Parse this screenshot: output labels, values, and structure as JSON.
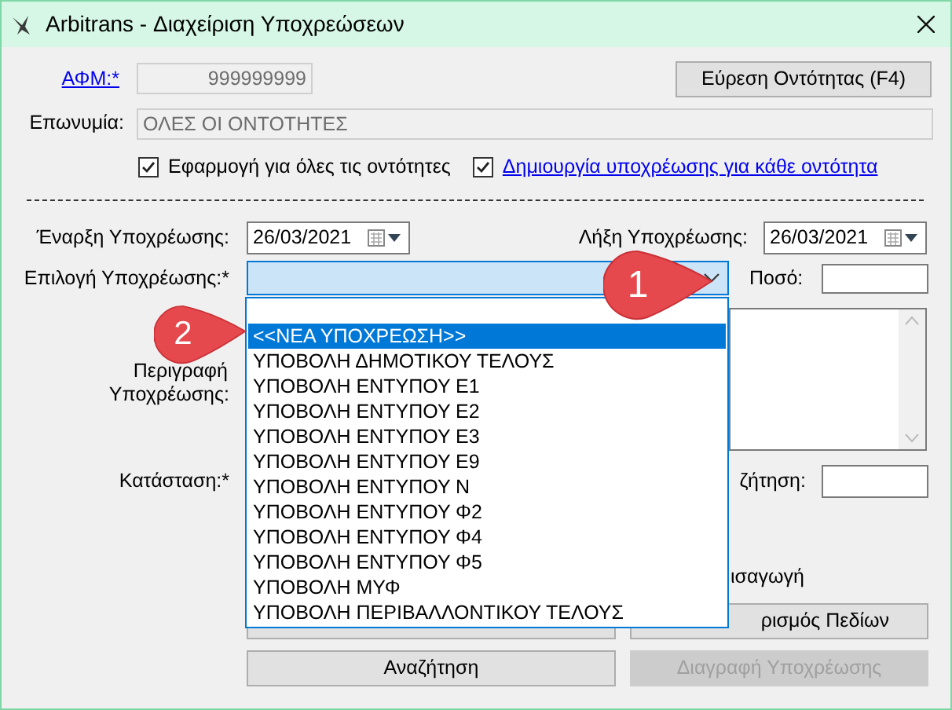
{
  "window": {
    "title": "Arbitrans - Διαχείριση Υποχρεώσεων"
  },
  "afm": {
    "label": "ΑΦΜ:*",
    "value": "999999999"
  },
  "find_button": {
    "label": "Εύρεση Οντότητας (F4)"
  },
  "name_field": {
    "label": "Επωνυμία:",
    "value": "ΟΛΕΣ ΟΙ ΟΝΤΟΤΗΤΕΣ"
  },
  "checkboxes": [
    {
      "label": "Εφαρμογή για όλες τις οντότητες",
      "checked": true,
      "kind": "plain"
    },
    {
      "label": "Δημιουργία υποχρέωσης για κάθε οντότητα",
      "checked": true,
      "kind": "link"
    }
  ],
  "start_date": {
    "label": "Έναρξη Υποχρέωσης:",
    "value": "26/03/2021"
  },
  "end_date": {
    "label": "Λήξη Υποχρέωσης:",
    "value": "26/03/2021"
  },
  "obligation": {
    "label": "Επιλογή Υποχρέωσης:*",
    "expanded": true,
    "options": [
      {
        "label": "<<ΝΕΑ ΥΠΟΧΡΕΩΣΗ>>",
        "selected": true
      },
      {
        "label": "ΥΠΟΒΟΛΗ ΔΗΜΟΤΙΚΟΥ ΤΕΛΟΥΣ",
        "selected": false
      },
      {
        "label": "ΥΠΟΒΟΛΗ ΕΝΤΥΠΟΥ Ε1",
        "selected": false
      },
      {
        "label": "ΥΠΟΒΟΛΗ ΕΝΤΥΠΟΥ Ε2",
        "selected": false
      },
      {
        "label": "ΥΠΟΒΟΛΗ ΕΝΤΥΠΟΥ Ε3",
        "selected": false
      },
      {
        "label": "ΥΠΟΒΟΛΗ ΕΝΤΥΠΟΥ Ε9",
        "selected": false
      },
      {
        "label": "ΥΠΟΒΟΛΗ ΕΝΤΥΠΟΥ Ν",
        "selected": false
      },
      {
        "label": "ΥΠΟΒΟΛΗ ΕΝΤΥΠΟΥ Φ2",
        "selected": false
      },
      {
        "label": "ΥΠΟΒΟΛΗ ΕΝΤΥΠΟΥ Φ4",
        "selected": false
      },
      {
        "label": "ΥΠΟΒΟΛΗ ΕΝΤΥΠΟΥ Φ5",
        "selected": false
      },
      {
        "label": "ΥΠΟΒΟΛΗ ΜΥΦ",
        "selected": false
      },
      {
        "label": "ΥΠΟΒΟΛΗ ΠΕΡΙΒΑΛΛΟΝΤΙΚΟΥ ΤΕΛΟΥΣ",
        "selected": false
      }
    ]
  },
  "amount": {
    "label": "Ποσό:"
  },
  "description": {
    "label_lines": [
      "Περιγραφή",
      "Υποχρέωσης:"
    ]
  },
  "status": {
    "label": "Κατάσταση:*"
  },
  "search_field": {
    "label": "ζήτηση:"
  },
  "import_label": "ισαγωγή",
  "buttons_row_1": [
    {
      "label": "ρισμός Πεδίων",
      "disabled": false
    }
  ],
  "buttons_row_2": [
    {
      "label": "Αναζήτηση",
      "disabled": false
    },
    {
      "label": "Διαγραφή Υποχρέωσης",
      "disabled": true
    }
  ],
  "callouts": [
    "1",
    "2"
  ]
}
